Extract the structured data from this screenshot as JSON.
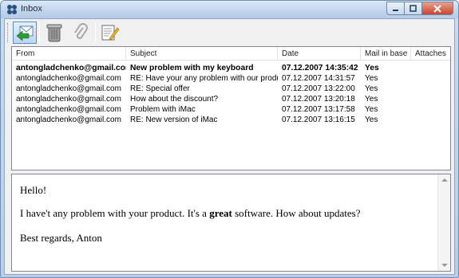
{
  "window": {
    "title": "Inbox"
  },
  "toolbar": {
    "buttons": [
      {
        "icon": "reply-icon",
        "active": true
      },
      {
        "icon": "trash-icon",
        "active": false
      },
      {
        "icon": "paperclip-icon",
        "active": false
      },
      {
        "icon": "compose-icon",
        "active": false
      }
    ]
  },
  "mail_list": {
    "columns": [
      "From",
      "Subject",
      "Date",
      "Mail in base",
      "Attaches"
    ],
    "rows": [
      {
        "from": "antongladchenko@gmail.com",
        "subject": "New problem with my keyboard",
        "date": "07.12.2007 14:35:42",
        "in_base": "Yes",
        "attaches": "",
        "unread": true
      },
      {
        "from": "antongladchenko@gmail.com",
        "subject": "RE: Have your any problem with our product?",
        "date": "07.12.2007 14:31:57",
        "in_base": "Yes",
        "attaches": "",
        "unread": false
      },
      {
        "from": "antongladchenko@gmail.com",
        "subject": "RE: Special offer",
        "date": "07.12.2007 13:22:00",
        "in_base": "Yes",
        "attaches": "",
        "unread": false
      },
      {
        "from": "antongladchenko@gmail.com",
        "subject": "How about the discount?",
        "date": "07.12.2007 13:20:18",
        "in_base": "Yes",
        "attaches": "",
        "unread": false
      },
      {
        "from": "antongladchenko@gmail.com",
        "subject": "Problem with iMac",
        "date": "07.12.2007 13:17:58",
        "in_base": "Yes",
        "attaches": "",
        "unread": false
      },
      {
        "from": "antongladchenko@gmail.com",
        "subject": "RE: New version of iMac",
        "date": "07.12.2007 13:16:15",
        "in_base": "Yes",
        "attaches": "",
        "unread": false
      }
    ]
  },
  "preview": {
    "greeting": "Hello!",
    "line_pre": "I have't any problem with your product. It's a ",
    "line_bold": "great",
    "line_post": " software. How about updates?",
    "signature": "Best regards, Anton"
  }
}
